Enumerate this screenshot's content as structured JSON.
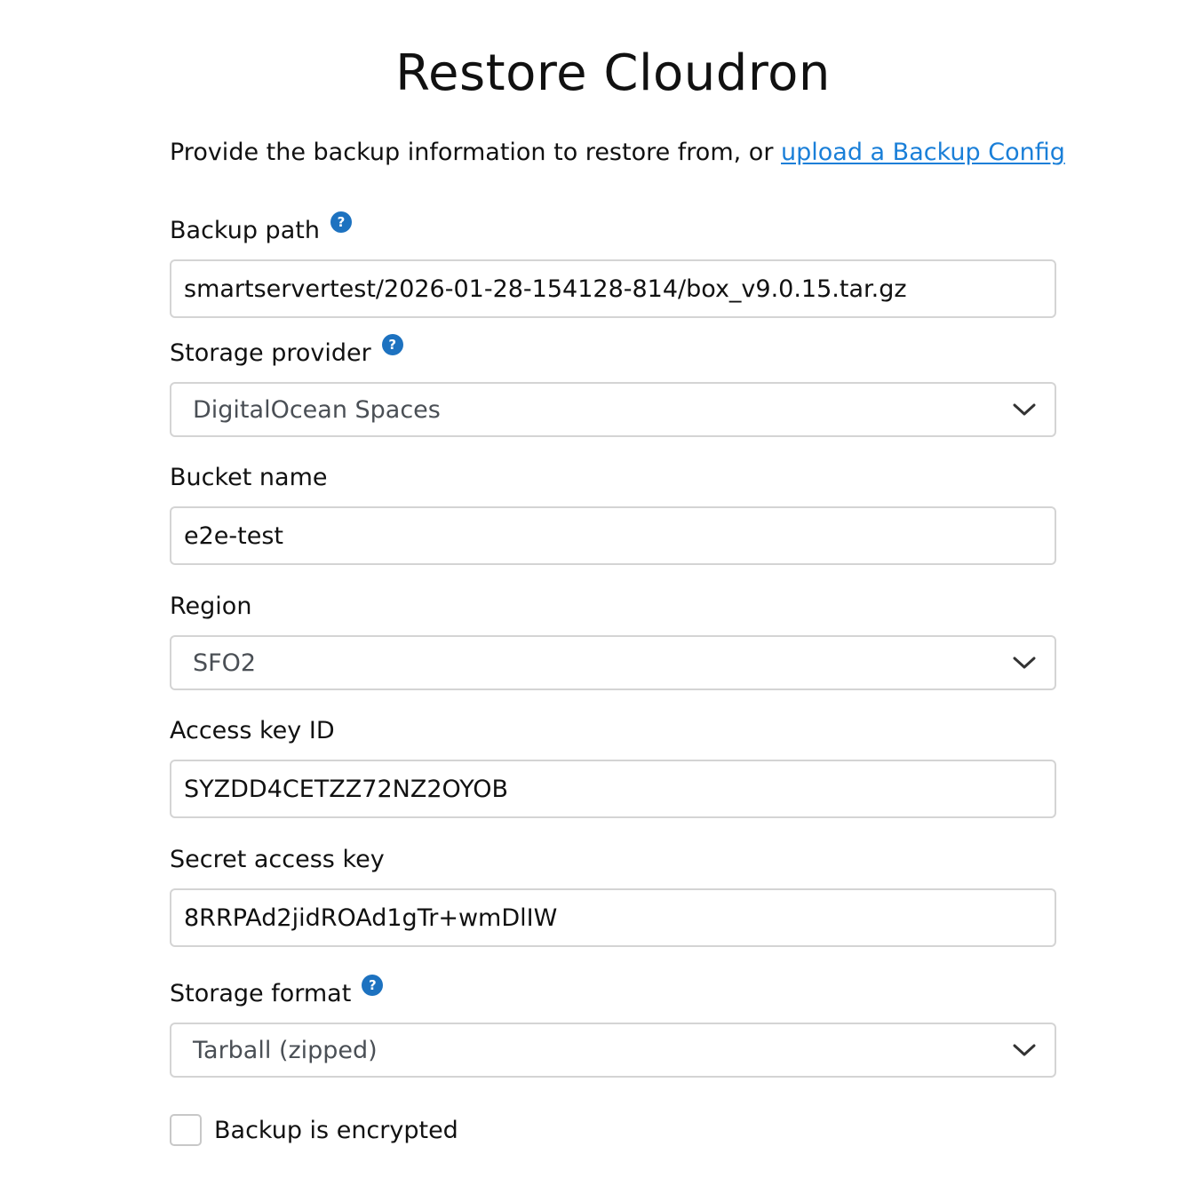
{
  "page": {
    "title": "Restore Cloudron",
    "intro_text": "Provide the backup information to restore from, or ",
    "intro_link": "upload a Backup Config"
  },
  "fields": {
    "backup_path": {
      "label": "Backup path",
      "value": "smartservertest/2026-01-28-154128-814/box_v9.0.15.tar.gz",
      "help_icon": "?"
    },
    "storage_provider": {
      "label": "Storage provider",
      "value": "DigitalOcean Spaces",
      "help_icon": "?"
    },
    "bucket_name": {
      "label": "Bucket name",
      "value": "e2e-test"
    },
    "region": {
      "label": "Region",
      "value": "SFO2"
    },
    "access_key_id": {
      "label": "Access key ID",
      "value": "SYZDD4CETZZ72NZ2OYOB"
    },
    "secret_access_key": {
      "label": "Secret access key",
      "value": "8RRPAd2jidROAd1gTr+wmDlIW"
    },
    "storage_format": {
      "label": "Storage format",
      "value": "Tarball (zipped)",
      "help_icon": "?"
    },
    "encrypted": {
      "label": "Backup is encrypted",
      "checked": false
    }
  },
  "colors": {
    "link": "#1a7fd8",
    "help_icon": "#1d72c0",
    "border": "#d4d4d4"
  },
  "icons": {
    "help": "help-circle-icon",
    "dropdown": "chevron-down-icon"
  }
}
